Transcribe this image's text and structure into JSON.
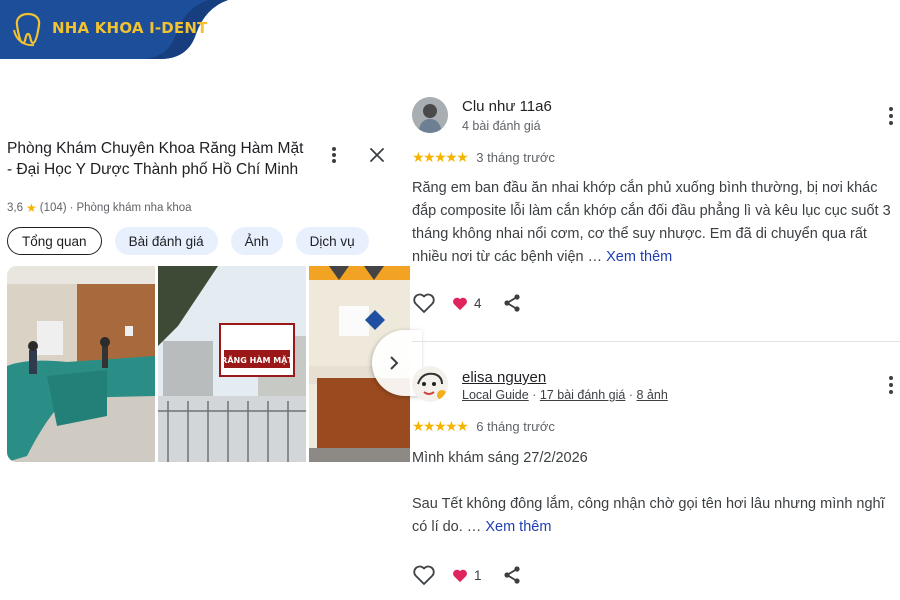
{
  "brand": {
    "name": "NHA KHOA I-DENT",
    "bg_color": "#1c4e9a",
    "text_color": "#f2c230"
  },
  "place": {
    "title": "Phòng Khám Chuyên Khoa Răng Hàm Mặt - Đại Học Y Dược Thành phố Hồ Chí Minh",
    "rating": "3,6",
    "review_count": "(104)",
    "category": "Phòng khám nha khoa",
    "more_icon": "more-vert-icon",
    "close_icon": "close-icon",
    "tabs": [
      {
        "label": "Tổng quan",
        "active": true
      },
      {
        "label": "Bài đánh giá",
        "active": false
      },
      {
        "label": "Ảnh",
        "active": false
      },
      {
        "label": "Dịch vụ",
        "active": false
      }
    ],
    "photo2_sign": "RĂNG HÀM MẶT"
  },
  "reviews": [
    {
      "name": "Clu như 11a6",
      "meta": "4 bài đánh giá",
      "stars": "★★★★★",
      "time": "3 tháng trước",
      "text": "Răng em ban đầu ăn nhai khớp cắn phủ xuống bình thường, bị nơi khác đắp composite lỗi làm cắn khớp cắn đối đầu phẳng lì và kêu lục cục suốt 3 tháng không nhai nổi cơm, cơ thể suy nhược. Em đã di chuyển qua rất nhiều nơi từ các bệnh viện …",
      "more_label": "Xem thêm",
      "likes": "4"
    },
    {
      "name": "elisa nguyen",
      "local_guide": "Local Guide",
      "sep": "·",
      "review_count": "17 bài đánh giá",
      "photo_count": "8 ảnh",
      "stars": "★★★★★",
      "time": "6 tháng trước",
      "line1": "Mình khám sáng 27/2/2026",
      "text": "Sau Tết không đông lắm, công nhận chờ gọi tên hơi lâu nhưng mình nghĩ có lí do. …",
      "more_label": "Xem thêm",
      "likes": "1"
    }
  ]
}
